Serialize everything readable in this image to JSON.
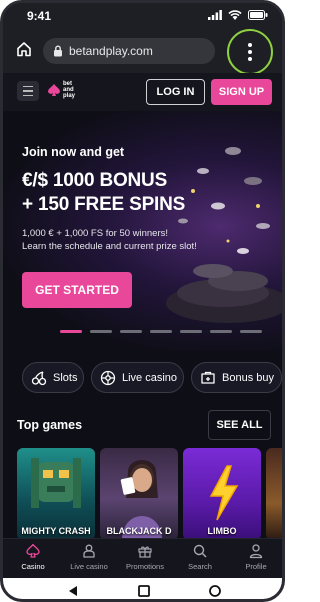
{
  "status_bar": {
    "time": "9:41"
  },
  "browser": {
    "url": "betandplay.com"
  },
  "header": {
    "logo_line1": "bet",
    "logo_line2": "and",
    "logo_line3": "play",
    "login_label": "LOG IN",
    "signup_label": "SIGN UP"
  },
  "hero": {
    "kicker": "Join now and get",
    "title_line1": "€/$ 1000 BONUS",
    "title_line2": "+ 150 FREE SPINS",
    "desc_line1": "1,000 € + 1,000 FS for 50 winners!",
    "desc_line2": "Learn the schedule and current prize slot!",
    "cta_label": "GET STARTED",
    "slides": 7,
    "active_slide": 1
  },
  "categories": [
    {
      "label": "Slots",
      "icon": "cherry-icon"
    },
    {
      "label": "Live casino",
      "icon": "roulette-icon"
    },
    {
      "label": "Bonus buy",
      "icon": "bonus-buy-icon"
    }
  ],
  "top_games": {
    "title": "Top games",
    "see_all_label": "SEE ALL",
    "games": [
      {
        "label": "MIGHTY CRASH"
      },
      {
        "label": "BLACKJACK D"
      },
      {
        "label": "LIMBO"
      }
    ]
  },
  "bottom_nav": {
    "items": [
      {
        "label": "Casino",
        "icon": "spade-icon",
        "active": true
      },
      {
        "label": "Live casino",
        "icon": "dealer-icon",
        "active": false
      },
      {
        "label": "Promotions",
        "icon": "gift-icon",
        "active": false
      },
      {
        "label": "Search",
        "icon": "search-icon",
        "active": false
      },
      {
        "label": "Profile",
        "icon": "profile-icon",
        "active": false
      }
    ]
  },
  "colors": {
    "accent": "#e9489a",
    "background": "#0e0e16",
    "highlight_ring": "#8ed040"
  }
}
